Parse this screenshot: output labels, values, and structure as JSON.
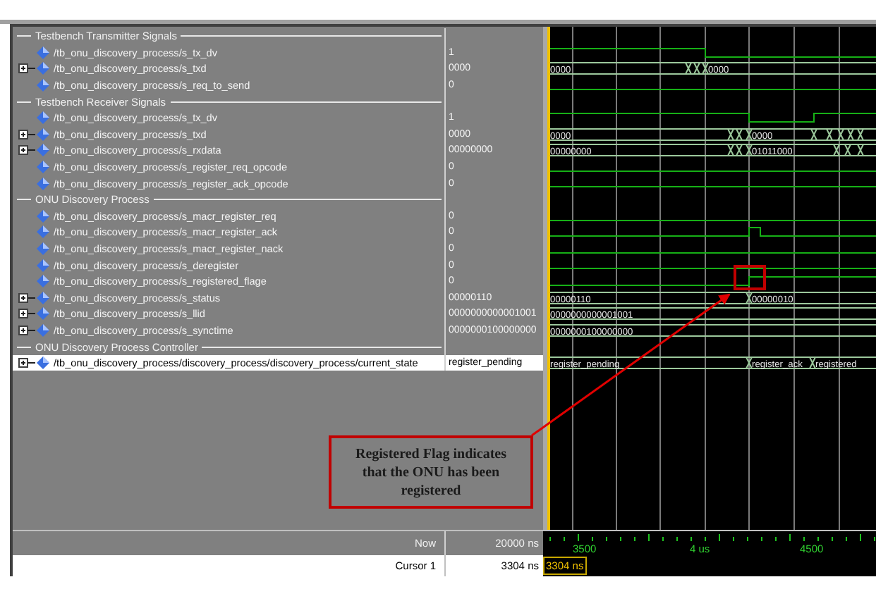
{
  "groups": [
    {
      "title": "Testbench Transmitter Signals",
      "signals": [
        {
          "name": "/tb_onu_discovery_process/s_tx_dv",
          "value": "1",
          "kind": "bit",
          "selected": false
        },
        {
          "name": "/tb_onu_discovery_process/s_txd",
          "value": "0000",
          "kind": "bus",
          "selected": false,
          "wave_labels": [
            "0000",
            "0000"
          ]
        },
        {
          "name": "/tb_onu_discovery_process/s_req_to_send",
          "value": "0",
          "kind": "bit",
          "selected": false
        }
      ]
    },
    {
      "title": "Testbench Receiver Signals",
      "signals": [
        {
          "name": "/tb_onu_discovery_process/s_tx_dv",
          "value": "1",
          "kind": "bit",
          "selected": false
        },
        {
          "name": "/tb_onu_discovery_process/s_txd",
          "value": "0000",
          "kind": "bus",
          "selected": false,
          "wave_labels": [
            "0000",
            "0000"
          ]
        },
        {
          "name": "/tb_onu_discovery_process/s_rxdata",
          "value": "00000000",
          "kind": "bus",
          "selected": false,
          "wave_labels": [
            "00000000",
            "01011000"
          ]
        },
        {
          "name": "/tb_onu_discovery_process/s_register_req_opcode",
          "value": "0",
          "kind": "bit",
          "selected": false
        },
        {
          "name": "/tb_onu_discovery_process/s_register_ack_opcode",
          "value": "0",
          "kind": "bit",
          "selected": false
        }
      ]
    },
    {
      "title": "ONU Discovery Process",
      "signals": [
        {
          "name": "/tb_onu_discovery_process/s_macr_register_req",
          "value": "0",
          "kind": "bit",
          "selected": false
        },
        {
          "name": "/tb_onu_discovery_process/s_macr_register_ack",
          "value": "0",
          "kind": "bit",
          "selected": false
        },
        {
          "name": "/tb_onu_discovery_process/s_macr_register_nack",
          "value": "0",
          "kind": "bit",
          "selected": false
        },
        {
          "name": "/tb_onu_discovery_process/s_deregister",
          "value": "0",
          "kind": "bit",
          "selected": false
        },
        {
          "name": "/tb_onu_discovery_process/s_registered_flage",
          "value": "0",
          "kind": "bit",
          "selected": false
        },
        {
          "name": "/tb_onu_discovery_process/s_status",
          "value": "00000110",
          "kind": "bus",
          "selected": false,
          "wave_labels": [
            "00000110",
            "00000010"
          ]
        },
        {
          "name": "/tb_onu_discovery_process/s_llid",
          "value": "0000000000001001",
          "kind": "bus",
          "selected": false,
          "wave_labels": [
            "0000000000001001"
          ]
        },
        {
          "name": "/tb_onu_discovery_process/s_synctime",
          "value": "0000000100000000",
          "kind": "bus",
          "selected": false,
          "wave_labels": [
            "0000000100000000"
          ]
        }
      ]
    },
    {
      "title": "ONU Discovery Process Controller",
      "signals": [
        {
          "name": "/tb_onu_discovery_process/discovery_process/discovery_process/current_state",
          "value": "register_pending",
          "kind": "bus",
          "selected": true,
          "wave_labels": [
            "register_pending",
            "register_ack",
            "registered"
          ]
        }
      ]
    }
  ],
  "now": {
    "label": "Now",
    "value": "20000 ns"
  },
  "timeline": {
    "ticks": [
      "3500",
      "4 us",
      "4500"
    ]
  },
  "cursor": {
    "label": "Cursor 1",
    "value": "3304 ns",
    "marker": "3304 ns"
  },
  "callout": {
    "text": "Registered Flag indicates that the ONU has been registered"
  }
}
